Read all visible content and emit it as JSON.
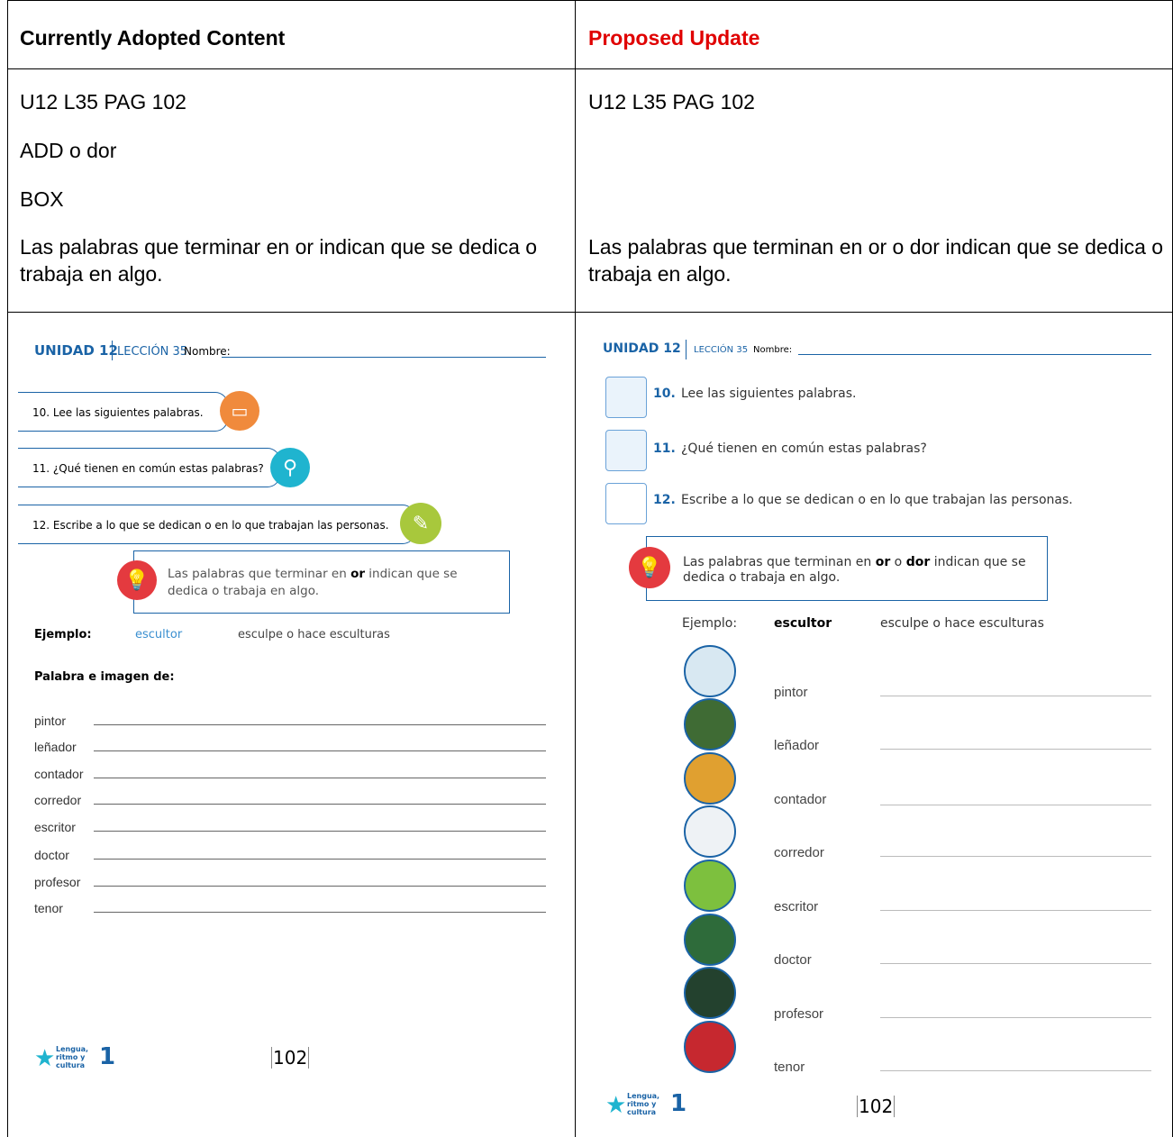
{
  "table": {
    "header": {
      "left": "Currently Adopted Content",
      "right": "Proposed Update"
    },
    "left_lines": [
      "U12 L35 PAG 102",
      "ADD o dor",
      "BOX",
      "Las palabras que terminar en or indican que se dedica o trabaja en algo."
    ],
    "right_lines": [
      "U12 L35 PAG 102",
      "Las palabras que terminan en or o dor indican que se dedica o trabaja en algo."
    ]
  },
  "left_ws": {
    "unidad": "UNIDAD 12",
    "leccion": "LECCIÓN 35",
    "nombre": "Nombre:",
    "q10": "10. Lee las siguientes palabras.",
    "q11": "11. ¿Qué tienen en común estas palabras?",
    "q12": "12. Escribe a lo que se dedican o en lo que trabajan las personas.",
    "box_pre": "Las palabras que terminar en ",
    "box_bold": "or",
    "box_post": " indican que se dedica o trabaja en algo.",
    "ejemplo": "Ejemplo:",
    "ej_word": "escultor",
    "ej_def": "esculpe o hace esculturas",
    "palabra": "Palabra e imagen de:",
    "words": [
      "pintor",
      "leñador",
      "contador",
      "corredor",
      "escritor",
      "doctor",
      "profesor",
      "tenor"
    ],
    "logo": "Lengua, ritmo y cultura",
    "logo_num": "1",
    "page": "102"
  },
  "right_ws": {
    "unidad": "UNIDAD 12",
    "leccion": "LECCIÓN 35",
    "nombre": "Nombre:",
    "q10_num": "10.",
    "q10": "Lee las siguientes palabras.",
    "q11_num": "11.",
    "q11": "¿Qué tienen en común estas palabras?",
    "q12_num": "12.",
    "q12": "Escribe a lo que se dedican o en lo que trabajan las personas.",
    "box_1": "Las palabras que terminan en ",
    "box_b1": "or",
    "box_2": " o ",
    "box_b2": "dor",
    "box_3": " indican que se",
    "box_4": "dedica o trabaja en algo.",
    "ejemplo": "Ejemplo:",
    "ej_word": "escultor",
    "ej_def": "esculpe o hace esculturas",
    "words": [
      "pintor",
      "leñador",
      "contador",
      "corredor",
      "escritor",
      "doctor",
      "profesor",
      "tenor"
    ],
    "logo": "Lengua, ritmo y cultura",
    "logo_num": "1",
    "page": "102"
  },
  "colors": {
    "accent_blue": "#1a63a6",
    "proposed_red": "#e00000",
    "orange": "#f08a3c",
    "teal": "#1fb4cf",
    "green": "#a8c83c",
    "bulb_red": "#e43a3f"
  }
}
